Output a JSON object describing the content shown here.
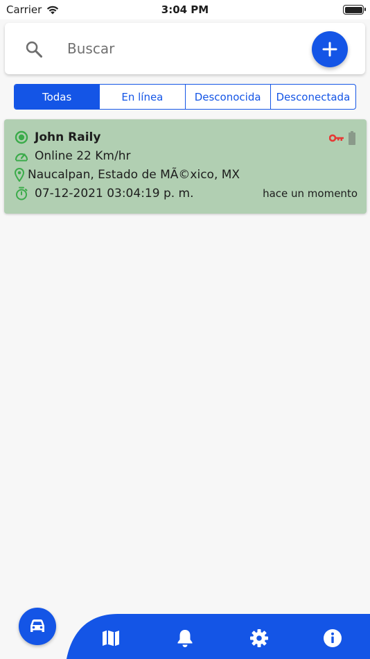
{
  "status_bar": {
    "carrier": "Carrier",
    "time": "3:04 PM"
  },
  "search": {
    "placeholder": "Buscar"
  },
  "filters": [
    {
      "label": "Todas",
      "active": true
    },
    {
      "label": "En línea",
      "active": false
    },
    {
      "label": "Desconocida",
      "active": false
    },
    {
      "label": "Desconectada",
      "active": false
    }
  ],
  "vehicle": {
    "name": "John Raily",
    "status": "Online 22 Km/hr",
    "location": "Naucalpan, Estado de MÃ©xico, MX",
    "timestamp": "07-12-2021 03:04:19 p. m.",
    "time_ago": "hace un momento"
  },
  "nav": {
    "items": [
      "car-icon",
      "map-icon",
      "bell-icon",
      "gear-icon",
      "info-icon"
    ]
  },
  "colors": {
    "primary": "#1455e6",
    "online_green": "#3bab4a",
    "card_bg": "#b1cfb2",
    "key_red": "#e53935"
  }
}
